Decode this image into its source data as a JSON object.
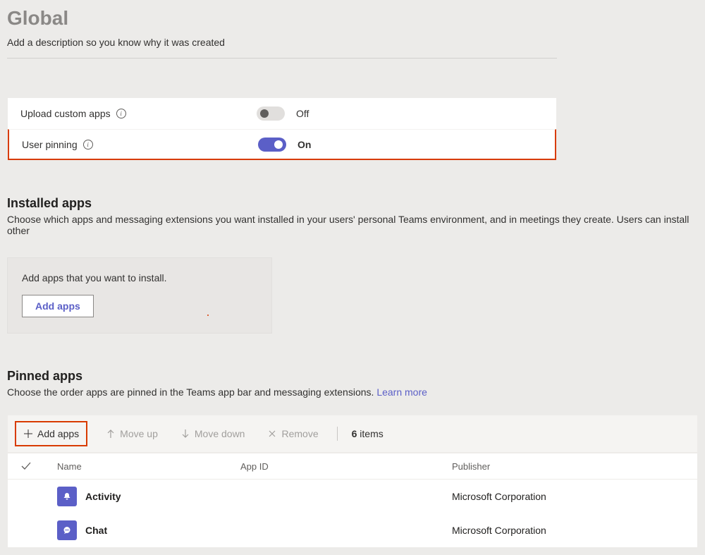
{
  "header": {
    "title": "Global",
    "description": "Add a description so you know why it was created"
  },
  "toggles": {
    "uploadCustom": {
      "label": "Upload custom apps",
      "state": "Off",
      "on": false
    },
    "userPinning": {
      "label": "User pinning",
      "state": "On",
      "on": true
    }
  },
  "installed": {
    "title": "Installed apps",
    "desc": "Choose which apps and messaging extensions you want installed in your users' personal Teams environment, and in meetings they create. Users can install other",
    "cardText": "Add apps that you want to install.",
    "addBtn": "Add apps"
  },
  "pinned": {
    "title": "Pinned apps",
    "desc": "Choose the order apps are pinned in the Teams app bar and messaging extensions. ",
    "learnMore": "Learn more"
  },
  "toolbar": {
    "addApps": "Add apps",
    "moveUp": "Move up",
    "moveDown": "Move down",
    "remove": "Remove",
    "count": "6",
    "countLabel": "items"
  },
  "table": {
    "headers": {
      "name": "Name",
      "appId": "App ID",
      "publisher": "Publisher"
    },
    "rows": [
      {
        "name": "Activity",
        "appId": "",
        "publisher": "Microsoft Corporation",
        "icon": "bell"
      },
      {
        "name": "Chat",
        "appId": "",
        "publisher": "Microsoft Corporation",
        "icon": "chat"
      }
    ]
  }
}
